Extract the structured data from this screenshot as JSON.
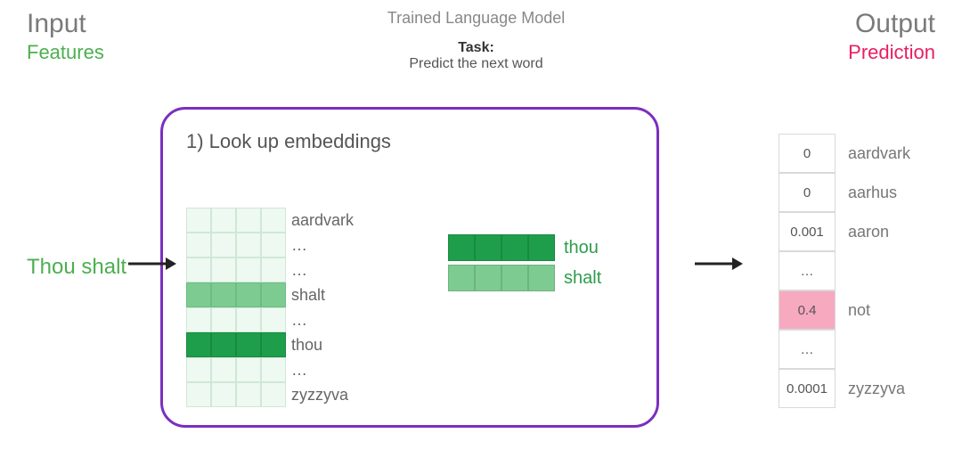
{
  "header": {
    "input_title": "Input",
    "input_sub": "Features",
    "center_title": "Trained Language Model",
    "task_label": "Task:",
    "task_desc": "Predict the next word",
    "output_title": "Output",
    "output_sub": "Prediction"
  },
  "input_text": "Thou shalt",
  "model": {
    "step_title": "1) Look up embeddings",
    "vocab_rows": [
      {
        "label": "aardvark",
        "shade": "light"
      },
      {
        "label": "…",
        "shade": "light"
      },
      {
        "label": "…",
        "shade": "light"
      },
      {
        "label": "shalt",
        "shade": "mid"
      },
      {
        "label": "…",
        "shade": "light"
      },
      {
        "label": "thou",
        "shade": "dark"
      },
      {
        "label": "…",
        "shade": "light"
      },
      {
        "label": "zyzzyva",
        "shade": "light"
      }
    ],
    "lookup": [
      {
        "label": "thou",
        "shade": "dark"
      },
      {
        "label": "shalt",
        "shade": "mid"
      }
    ]
  },
  "output": [
    {
      "value": "0",
      "label": "aardvark",
      "highlight": false
    },
    {
      "value": "0",
      "label": "aarhus",
      "highlight": false
    },
    {
      "value": "0.001",
      "label": "aaron",
      "highlight": false
    },
    {
      "value": "…",
      "label": "",
      "highlight": false
    },
    {
      "value": "0.4",
      "label": "not",
      "highlight": true
    },
    {
      "value": "…",
      "label": "",
      "highlight": false
    },
    {
      "value": "0.0001",
      "label": "zyzzyva",
      "highlight": false
    }
  ],
  "colors": {
    "purple": "#7b2fbf",
    "green_dark": "#1e9e4a",
    "green_mid": "#7ecb92",
    "green_light": "#eef9f1",
    "pink": "#f7a9c0",
    "prediction": "#e91e63",
    "features": "#4caf50"
  }
}
